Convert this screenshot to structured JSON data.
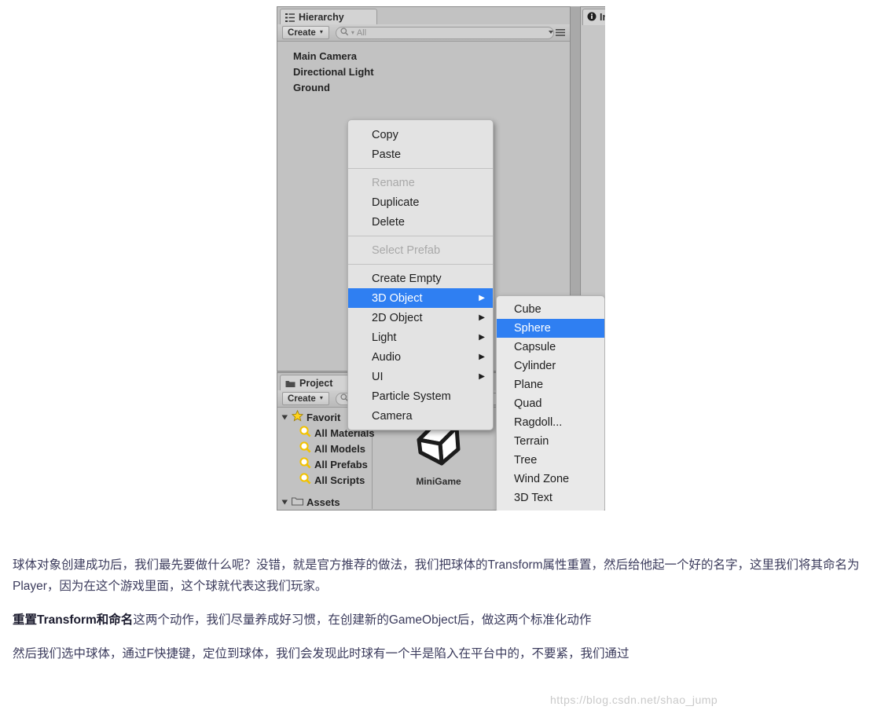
{
  "editor": {
    "hierarchy": {
      "tab_label": "Hierarchy",
      "tab_icon": "hierarchy-icon",
      "create_label": "Create",
      "create_caret": "▾",
      "search_placeholder": "All",
      "search_icon": "search-icon",
      "panel_menu_icon": "panel-options-icon",
      "items": [
        {
          "label": "Main Camera"
        },
        {
          "label": "Directional Light"
        },
        {
          "label": "Ground"
        }
      ]
    },
    "inspector": {
      "tab_label": "In",
      "tab_icon": "info-icon"
    },
    "project": {
      "tab_label": "Project",
      "tab_icon": "folder-icon",
      "create_label": "Create",
      "create_caret": "▾",
      "favorites_label": "Favorit",
      "favorites_icon": "star-icon",
      "disclosure_icon": "triangle-down-icon",
      "favorites": [
        {
          "label": "All Materials",
          "icon": "search-icon"
        },
        {
          "label": "All Models",
          "icon": "search-icon"
        },
        {
          "label": "All Prefabs",
          "icon": "search-icon"
        },
        {
          "label": "All Scripts",
          "icon": "search-icon"
        }
      ],
      "assets_label": "Assets",
      "assets_icon": "folder-icon",
      "asset_tile": {
        "label": "MiniGame",
        "icon": "unity-logo-icon"
      }
    },
    "context_menu": {
      "groups": [
        {
          "items": [
            {
              "label": "Copy",
              "disabled": false,
              "selected": false,
              "submenu": false
            },
            {
              "label": "Paste",
              "disabled": false,
              "selected": false,
              "submenu": false
            }
          ]
        },
        {
          "items": [
            {
              "label": "Rename",
              "disabled": true,
              "selected": false,
              "submenu": false
            },
            {
              "label": "Duplicate",
              "disabled": false,
              "selected": false,
              "submenu": false
            },
            {
              "label": "Delete",
              "disabled": false,
              "selected": false,
              "submenu": false
            }
          ]
        },
        {
          "items": [
            {
              "label": "Select Prefab",
              "disabled": true,
              "selected": false,
              "submenu": false
            }
          ]
        },
        {
          "items": [
            {
              "label": "Create Empty",
              "disabled": false,
              "selected": false,
              "submenu": false
            },
            {
              "label": "3D Object",
              "disabled": false,
              "selected": true,
              "submenu": true
            },
            {
              "label": "2D Object",
              "disabled": false,
              "selected": false,
              "submenu": true
            },
            {
              "label": "Light",
              "disabled": false,
              "selected": false,
              "submenu": true
            },
            {
              "label": "Audio",
              "disabled": false,
              "selected": false,
              "submenu": true
            },
            {
              "label": "UI",
              "disabled": false,
              "selected": false,
              "submenu": true
            },
            {
              "label": "Particle System",
              "disabled": false,
              "selected": false,
              "submenu": false
            },
            {
              "label": "Camera",
              "disabled": false,
              "selected": false,
              "submenu": false
            }
          ]
        }
      ],
      "submenu_arrow": "▶"
    },
    "submenu_3d_object": {
      "items": [
        {
          "label": "Cube",
          "selected": false
        },
        {
          "label": "Sphere",
          "selected": true
        },
        {
          "label": "Capsule",
          "selected": false
        },
        {
          "label": "Cylinder",
          "selected": false
        },
        {
          "label": "Plane",
          "selected": false
        },
        {
          "label": "Quad",
          "selected": false
        },
        {
          "label": "Ragdoll...",
          "selected": false
        },
        {
          "label": "Terrain",
          "selected": false
        },
        {
          "label": "Tree",
          "selected": false
        },
        {
          "label": "Wind Zone",
          "selected": false
        },
        {
          "label": "3D Text",
          "selected": false
        }
      ]
    },
    "colors": {
      "selection_blue": "#2f7ff2",
      "panel_gray": "#c2c2c2",
      "menu_gray": "#e3e3e3"
    }
  },
  "article": {
    "paragraphs": [
      {
        "parts": [
          {
            "text": "球体对象创建成功后，我们最先要做什么呢？没错，就是官方推荐的做法，我们把球体的Transform属性重置，然后给他起一个好的名字，这里我们将其命名为Player，因为在这个游戏里面，这个球就代表这我们玩家。",
            "bold": false
          }
        ]
      },
      {
        "parts": [
          {
            "text": "重置Transform和命名",
            "bold": true
          },
          {
            "text": "这两个动作，我们尽量养成好习惯，在创建新的GameObject后，做这两个标准化动作",
            "bold": false
          }
        ]
      },
      {
        "parts": [
          {
            "text": "然后我们选中球体，通过F快捷键，定位到球体，我们会发现此时球有一个半是陷入在平台中的，不要紧，我们通过",
            "bold": false
          }
        ]
      }
    ]
  },
  "watermark": {
    "text": "https://blog.csdn.net/shao_jump"
  }
}
